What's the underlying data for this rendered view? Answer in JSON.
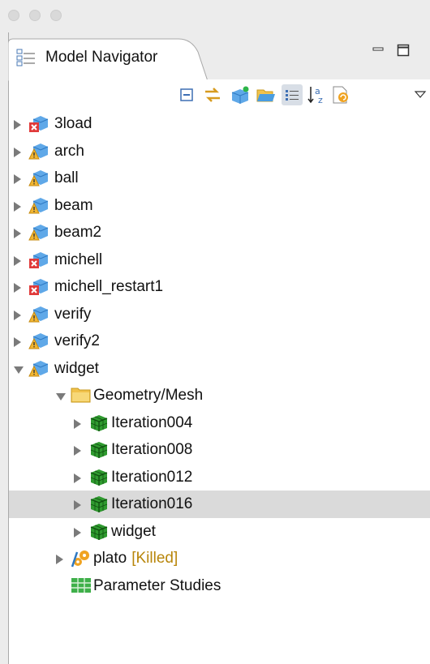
{
  "window": {
    "traffic_lights": [
      "close",
      "minimize",
      "zoom"
    ]
  },
  "view": {
    "tab_title": "Model Navigator",
    "icon": "tree-outline-icon",
    "controls": [
      "minimize-icon",
      "maximize-icon"
    ]
  },
  "toolbar": {
    "buttons": [
      {
        "name": "collapse-all-icon"
      },
      {
        "name": "link-with-editor-icon"
      },
      {
        "name": "new-model-icon"
      },
      {
        "name": "open-folder-icon"
      },
      {
        "name": "list-view-icon",
        "pressed": true
      },
      {
        "name": "sort-az-icon"
      },
      {
        "name": "refresh-icon"
      },
      {
        "name": "view-menu-icon"
      }
    ]
  },
  "tree": {
    "items": [
      {
        "label": "3load",
        "type": "model-error",
        "level": 0,
        "expander": "collapsed"
      },
      {
        "label": "arch",
        "type": "model-warning",
        "level": 0,
        "expander": "collapsed"
      },
      {
        "label": "ball",
        "type": "model-warning",
        "level": 0,
        "expander": "collapsed"
      },
      {
        "label": "beam",
        "type": "model-warning",
        "level": 0,
        "expander": "collapsed"
      },
      {
        "label": "beam2",
        "type": "model-warning",
        "level": 0,
        "expander": "collapsed"
      },
      {
        "label": "michell",
        "type": "model-error",
        "level": 0,
        "expander": "collapsed"
      },
      {
        "label": "michell_restart1",
        "type": "model-error",
        "level": 0,
        "expander": "collapsed"
      },
      {
        "label": "verify",
        "type": "model-warning",
        "level": 0,
        "expander": "collapsed"
      },
      {
        "label": "verify2",
        "type": "model-warning",
        "level": 0,
        "expander": "collapsed"
      },
      {
        "label": "widget",
        "type": "model-warning",
        "level": 0,
        "expander": "expanded"
      },
      {
        "label": "Geometry/Mesh",
        "type": "folder",
        "level": 1,
        "expander": "expanded"
      },
      {
        "label": "Iteration004",
        "type": "mesh",
        "level": 2,
        "expander": "collapsed"
      },
      {
        "label": "Iteration008",
        "type": "mesh",
        "level": 2,
        "expander": "collapsed"
      },
      {
        "label": "Iteration012",
        "type": "mesh",
        "level": 2,
        "expander": "collapsed"
      },
      {
        "label": "Iteration016",
        "type": "mesh",
        "level": 2,
        "expander": "collapsed",
        "selected": true
      },
      {
        "label": "widget",
        "type": "mesh",
        "level": 2,
        "expander": "collapsed"
      },
      {
        "label": "plato",
        "status": "[Killed]",
        "type": "job",
        "level": 1,
        "expander": "collapsed"
      },
      {
        "label": "Parameter Studies",
        "type": "table",
        "level": 1,
        "expander": "none"
      }
    ]
  },
  "colors": {
    "selection": "#dadada",
    "status_text": "#b8860b",
    "error_badge": "#e03a3a",
    "warning_badge": "#f2b632",
    "model_blue": "#4a9de0",
    "folder": "#f1c24b",
    "mesh_green": "#2f9a2f"
  }
}
